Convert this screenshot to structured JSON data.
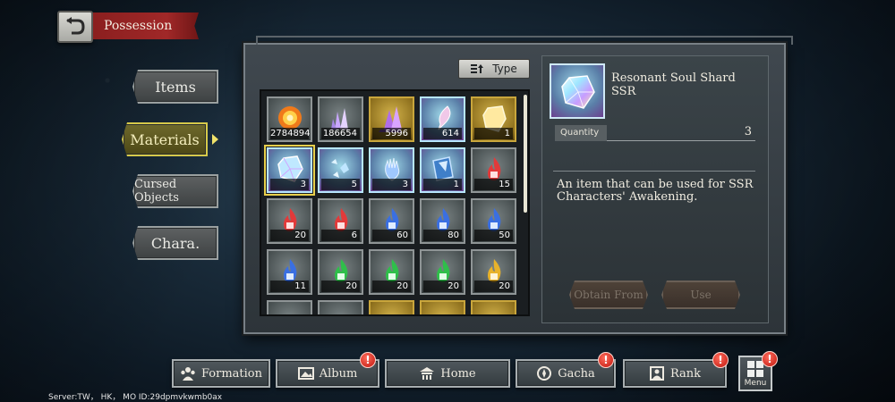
{
  "header": {
    "title": "Possession"
  },
  "side_tabs": [
    {
      "label": "Items",
      "active": false
    },
    {
      "label": "Materials",
      "active": true
    },
    {
      "label": "Cursed Objects",
      "active": false
    },
    {
      "label": "Chara.",
      "active": false
    }
  ],
  "filter": {
    "type_label": "Type"
  },
  "items": [
    {
      "icon": "fire-orb-icon",
      "count": "2784894",
      "rarity": "grey"
    },
    {
      "icon": "crystal-cluster-icon",
      "count": "186654",
      "rarity": "grey"
    },
    {
      "icon": "purple-crystal-icon",
      "count": "5996",
      "rarity": "gold"
    },
    {
      "icon": "feather-quill-icon",
      "count": "614",
      "rarity": "rainbow"
    },
    {
      "icon": "gold-shard-icon",
      "count": "1",
      "rarity": "gold"
    },
    {
      "icon": "rainbow-shard-icon",
      "count": "3",
      "rarity": "rainbow",
      "selected": true
    },
    {
      "icon": "crystal-fragments-icon",
      "count": "5",
      "rarity": "rainbow"
    },
    {
      "icon": "spirit-hand-icon",
      "count": "3",
      "rarity": "rainbow"
    },
    {
      "icon": "blue-book-icon",
      "count": "1",
      "rarity": "rainbow"
    },
    {
      "icon": "red-flame-icon",
      "count": "15",
      "rarity": "grey"
    },
    {
      "icon": "red-flame-icon",
      "count": "20",
      "rarity": "grey"
    },
    {
      "icon": "red-flame-icon",
      "count": "6",
      "rarity": "grey"
    },
    {
      "icon": "blue-flame-icon",
      "count": "60",
      "rarity": "grey"
    },
    {
      "icon": "blue-flame-icon",
      "count": "80",
      "rarity": "grey"
    },
    {
      "icon": "blue-flame-icon",
      "count": "50",
      "rarity": "grey"
    },
    {
      "icon": "blue-flame-icon",
      "count": "11",
      "rarity": "grey"
    },
    {
      "icon": "green-flame-icon",
      "count": "20",
      "rarity": "grey"
    },
    {
      "icon": "green-flame-icon",
      "count": "20",
      "rarity": "grey"
    },
    {
      "icon": "green-flame-icon",
      "count": "20",
      "rarity": "grey"
    },
    {
      "icon": "gold-flame-icon",
      "count": "20",
      "rarity": "grey"
    },
    {
      "icon": "item-icon",
      "count": "",
      "rarity": "grey"
    },
    {
      "icon": "item-icon",
      "count": "",
      "rarity": "grey"
    },
    {
      "icon": "item-icon",
      "count": "",
      "rarity": "gold"
    },
    {
      "icon": "item-icon",
      "count": "",
      "rarity": "gold"
    },
    {
      "icon": "item-icon",
      "count": "",
      "rarity": "gold"
    }
  ],
  "detail": {
    "name": "Resonant Soul Shard SSR",
    "quantity_label": "Quantity",
    "quantity": "3",
    "description": "An item that can be used for SSR Characters' Awakening.",
    "obtain_label": "Obtain From",
    "use_label": "Use"
  },
  "nav": [
    {
      "label": "Formation",
      "badge": ""
    },
    {
      "label": "Album",
      "badge": "!"
    },
    {
      "label": "Home",
      "badge": ""
    },
    {
      "label": "Gacha",
      "badge": "!"
    },
    {
      "label": "Rank",
      "badge": "!"
    }
  ],
  "menu": {
    "label": "Menu",
    "badge": "!"
  },
  "footer": {
    "server": "Server:TW， HK， MO ID:29dpmvkwmb0ax"
  },
  "colors": {
    "accent_gold": "#d6c94a",
    "banner_red": "#a02828",
    "badge_red": "#c0170f"
  }
}
